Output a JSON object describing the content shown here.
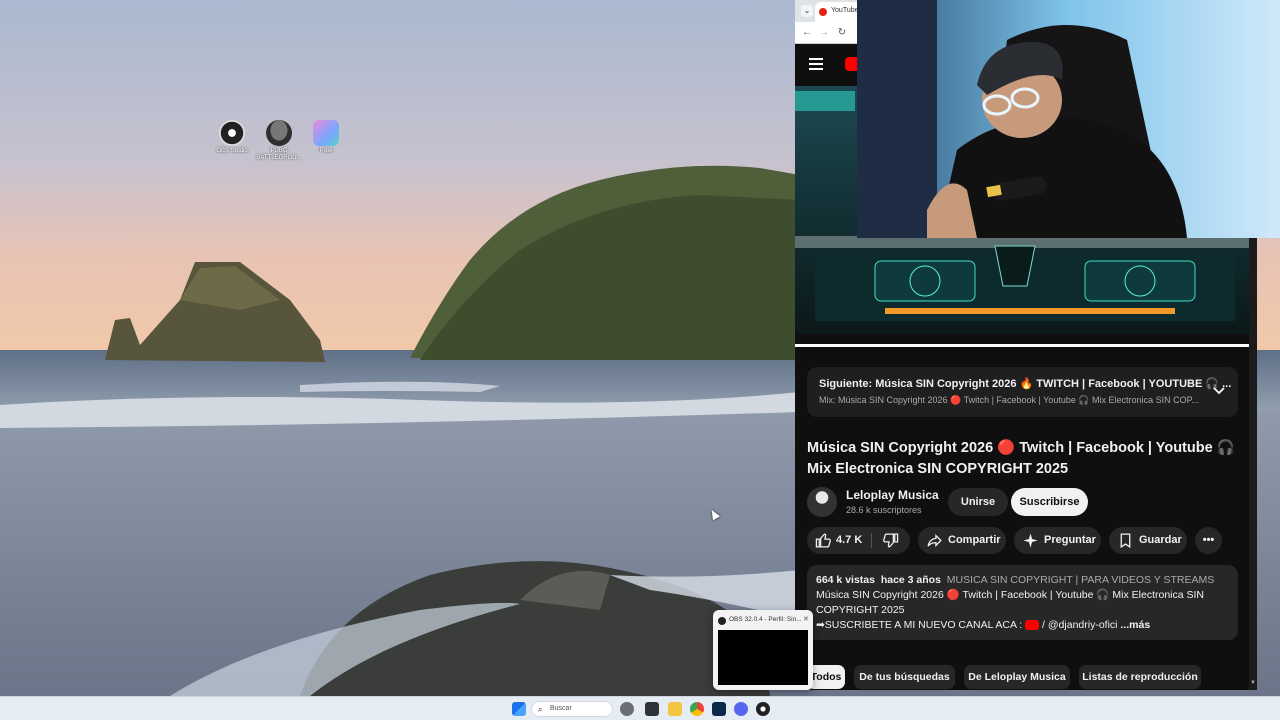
{
  "desktop": {
    "icons": [
      {
        "label": "OBS Studio",
        "icon": "obs-studio-icon"
      },
      {
        "label": "PUBG BATTLEGROU...",
        "icon": "pubg-icon"
      },
      {
        "label": "Pixel",
        "icon": "photo-app-icon"
      }
    ]
  },
  "browser": {
    "tab_title": "YouTube",
    "yt": {
      "up_next_title": "Siguiente: Música SIN Copyright 2026 🔥 TWITCH | Facebook | YOUTUBE 🎧 ...",
      "up_next_subtitle": "Mix: Música SIN Copyright 2026 🔴 Twitch | Facebook | Youtube 🎧 Mix Electronica SIN COP...",
      "video_title": "Música SIN Copyright 2026 🔴 Twitch | Facebook | Youtube 🎧 Mix Electronica SIN COPYRIGHT 2025",
      "channel_name": "Leloplay Musica",
      "channel_subs": "28.6 k suscriptores",
      "join_label": "Unirse",
      "subscribe_label": "Suscribirse",
      "like_count": "4.7 K",
      "share_label": "Compartir",
      "ask_label": "Preguntar",
      "save_label": "Guardar",
      "more_label": "•••",
      "desc_views": "664 k vistas",
      "desc_age": "hace 3 años",
      "desc_tags": "MUSICA SIN COPYRIGHT | PARA VIDEOS Y STREAMS",
      "desc_line1": "Música SIN Copyright 2026 🔴 Twitch | Facebook | Youtube 🎧 Mix Electronica SIN COPYRIGHT 2025",
      "desc_line2_prefix": "➡SUSCRIBETE A MI NUEVO CANAL ACA : ",
      "desc_line2_handle": " / @djandriy-ofici",
      "desc_more": "...más",
      "chips": [
        "Todos",
        "De tus búsquedas",
        "De Leloplay Musica",
        "Listas de reproducción"
      ]
    }
  },
  "obs": {
    "window_title": "OBS 32.0.4 - Perfil: Sin..."
  },
  "taskbar": {
    "search_placeholder": "Buscar"
  },
  "colors": {
    "yt_bg": "#0f0f0f",
    "yt_surface": "#272727",
    "yt_red": "#ff0000",
    "taskbar": "#e6ecf3"
  }
}
